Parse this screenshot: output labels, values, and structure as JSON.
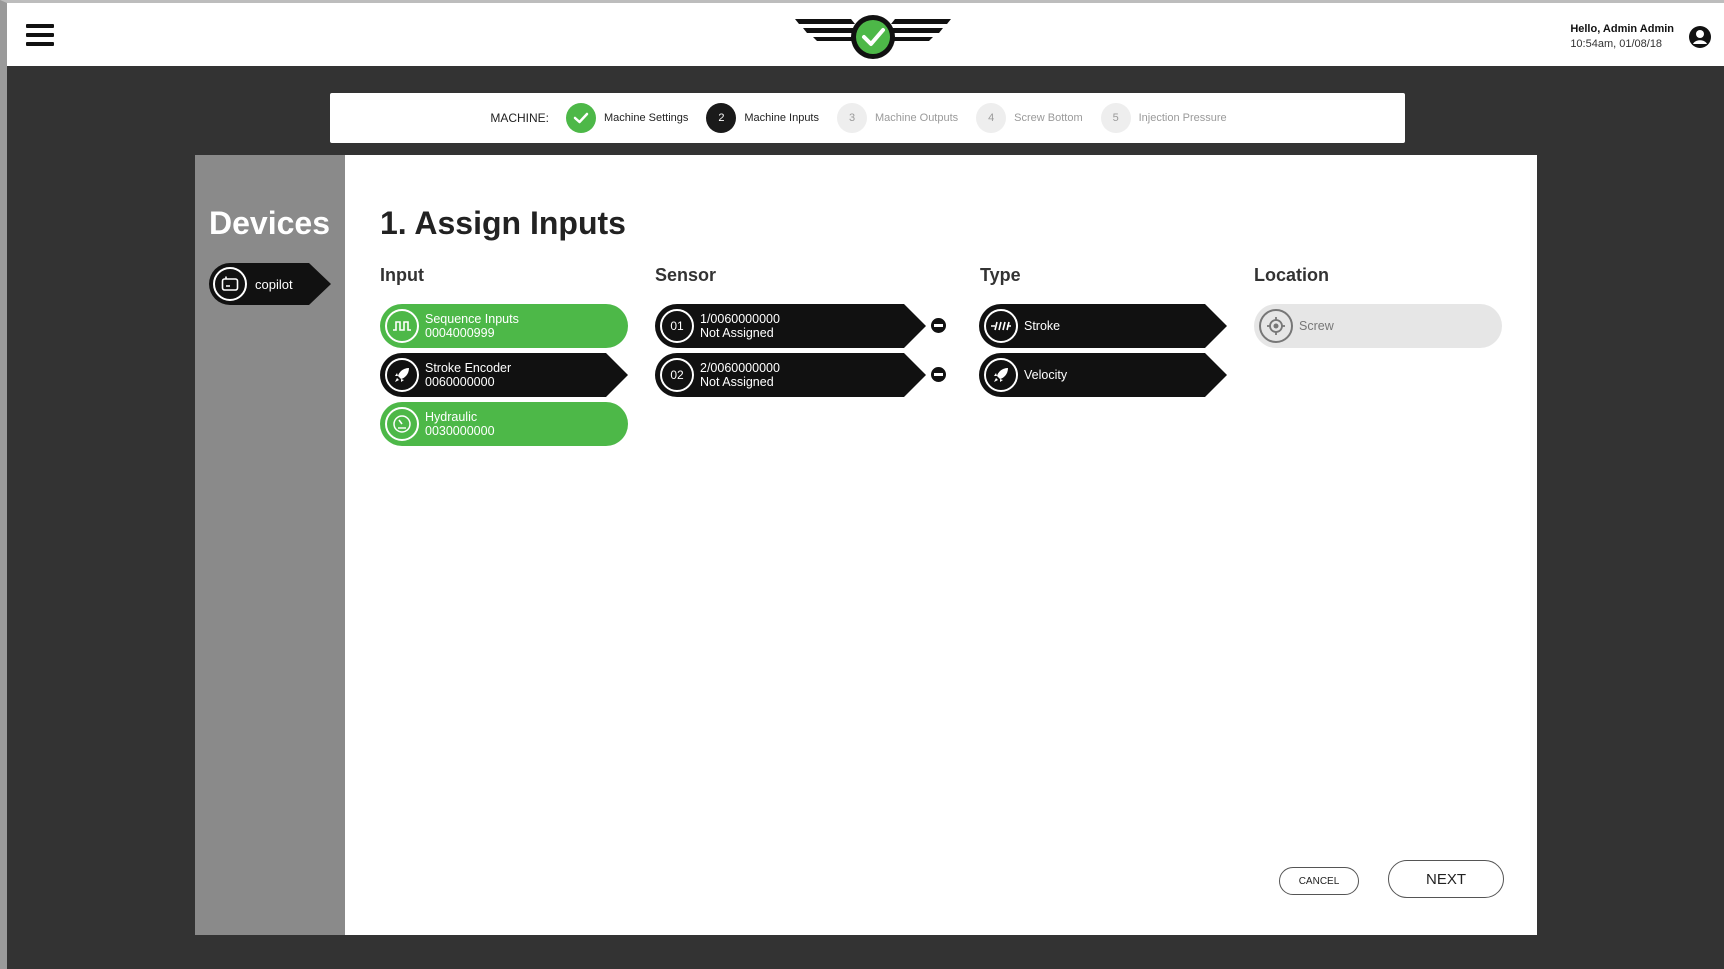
{
  "header": {
    "user_greeting": "Hello, Admin Admin",
    "timestamp": "10:54am, 01/08/18",
    "menu_icon": "hamburger-icon",
    "user_icon": "user-circle-icon"
  },
  "stepper": {
    "label": "MACHINE:",
    "steps": [
      {
        "number": "",
        "label": "Machine Settings",
        "state": "done"
      },
      {
        "number": "2",
        "label": "Machine Inputs",
        "state": "active"
      },
      {
        "number": "3",
        "label": "Machine Outputs",
        "state": "todo"
      },
      {
        "number": "4",
        "label": "Screw Bottom",
        "state": "todo"
      },
      {
        "number": "5",
        "label": "Injection Pressure",
        "state": "todo"
      }
    ]
  },
  "sidebar": {
    "title": "Devices",
    "devices": [
      {
        "label": "copilot",
        "icon": "device-icon"
      }
    ]
  },
  "main": {
    "title": "1. Assign Inputs",
    "columns": {
      "input": "Input",
      "sensor": "Sensor",
      "type": "Type",
      "location": "Location"
    },
    "inputs": [
      {
        "name": "Sequence Inputs",
        "serial": "0004000999",
        "style": "green",
        "icon": "pulse-wave-icon"
      },
      {
        "name": "Stroke Encoder",
        "serial": "0060000000",
        "style": "black",
        "icon": "rocket-icon"
      },
      {
        "name": "Hydraulic",
        "serial": "0030000000",
        "style": "green",
        "icon": "gauge-icon"
      }
    ],
    "sensors": [
      {
        "index": "01",
        "id": "1/0060000000",
        "status": "Not Assigned"
      },
      {
        "index": "02",
        "id": "2/0060000000",
        "status": "Not Assigned"
      }
    ],
    "types": [
      {
        "label": "Stroke",
        "icon": "stroke-icon"
      },
      {
        "label": "Velocity",
        "icon": "rocket-icon"
      }
    ],
    "locations": [
      {
        "label": "Screw",
        "icon": "target-icon"
      }
    ]
  },
  "actions": {
    "cancel_label": "CANCEL",
    "next_label": "NEXT"
  },
  "colors": {
    "accent_green": "#4db848",
    "background_dark": "#333333",
    "sidebar_gray": "#8a8a8a"
  }
}
